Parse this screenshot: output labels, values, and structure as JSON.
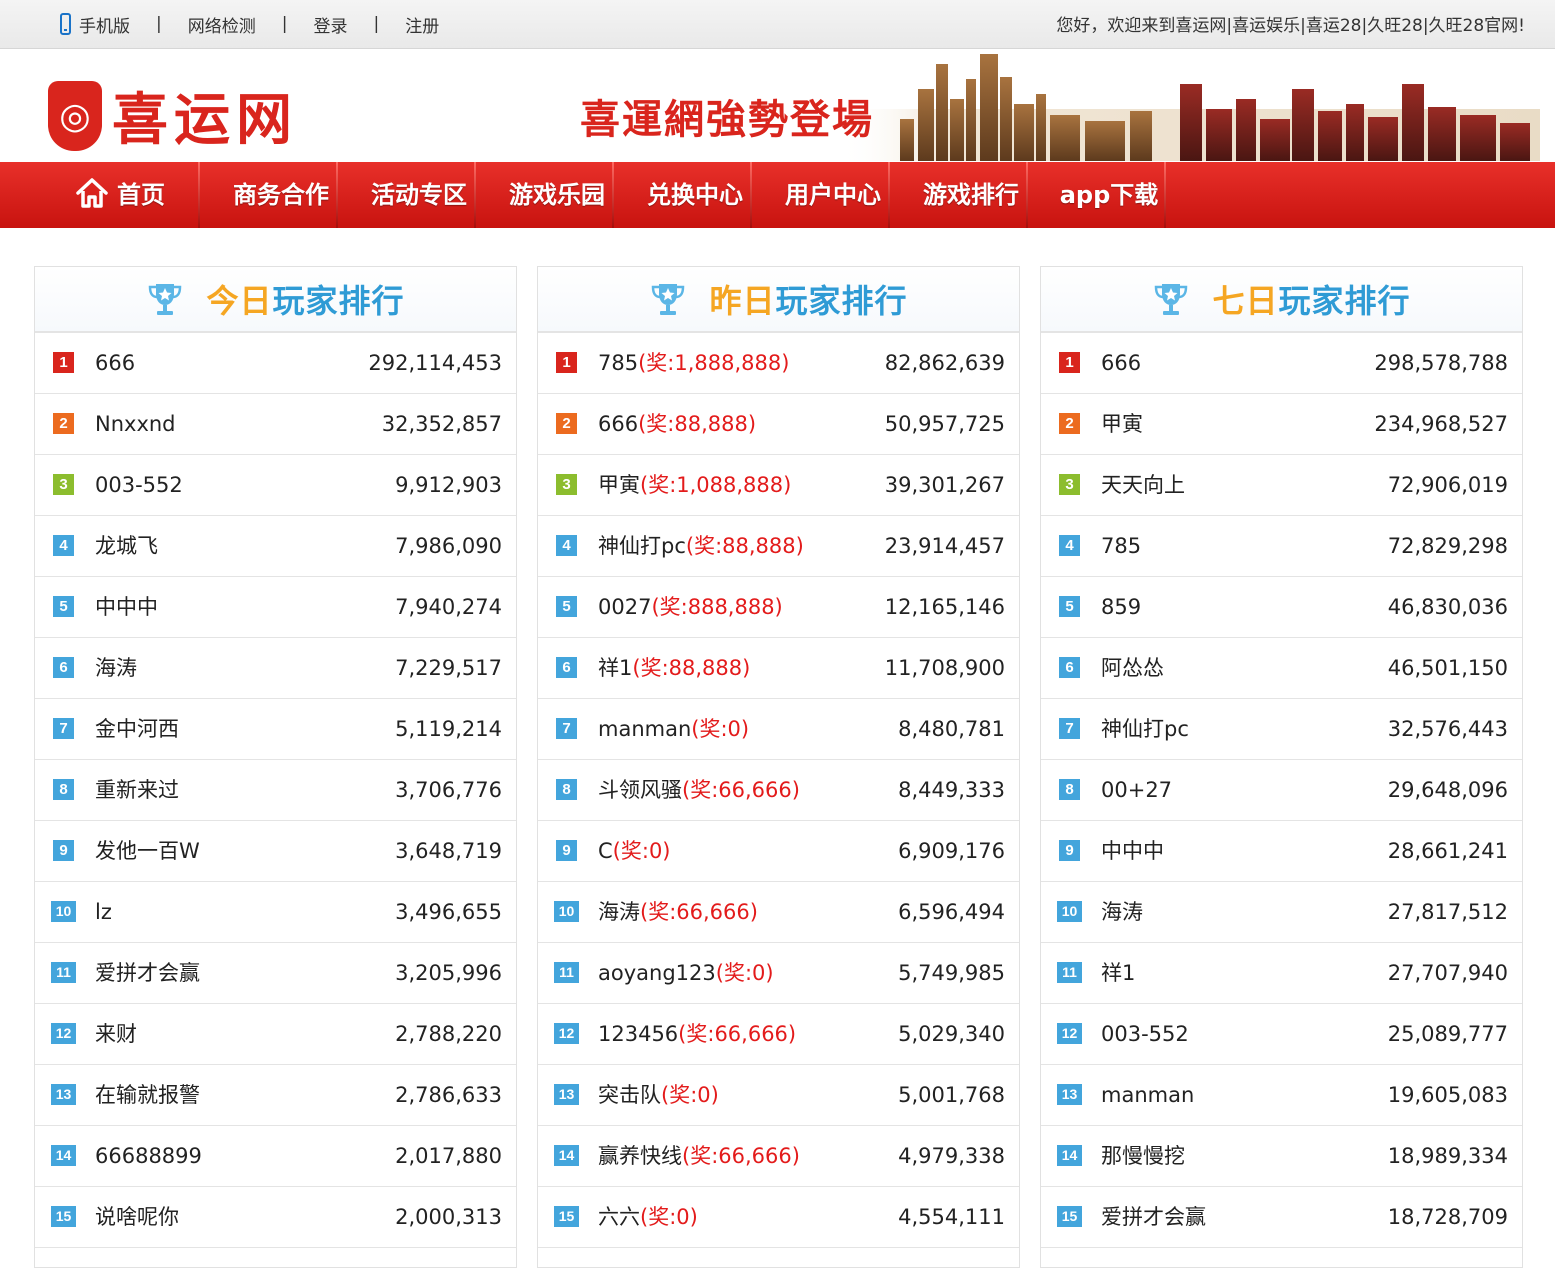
{
  "topbar": {
    "mobile": "手机版",
    "network_check": "网络检测",
    "login": "登录",
    "register": "注册",
    "separator": "|",
    "welcome": "您好，欢迎来到喜运网|喜运娱乐|喜运28|久旺28|久旺28官网!"
  },
  "header": {
    "logo_text": "喜运网",
    "slogan": "喜運網強勢登場"
  },
  "nav": {
    "items": [
      "首页",
      "商务合作",
      "活动专区",
      "游戏乐园",
      "兑换中心",
      "用户中心",
      "游戏排行",
      "app下载"
    ]
  },
  "panels": [
    {
      "title_a": "今日",
      "title_b": "玩家排行",
      "rows": [
        {
          "rank": "1",
          "name": "666",
          "prize": "",
          "score": "292,114,453"
        },
        {
          "rank": "2",
          "name": "Nnxxnd",
          "prize": "",
          "score": "32,352,857"
        },
        {
          "rank": "3",
          "name": "003-552",
          "prize": "",
          "score": "9,912,903"
        },
        {
          "rank": "4",
          "name": "龙城飞",
          "prize": "",
          "score": "7,986,090"
        },
        {
          "rank": "5",
          "name": "中中中",
          "prize": "",
          "score": "7,940,274"
        },
        {
          "rank": "6",
          "name": "海涛",
          "prize": "",
          "score": "7,229,517"
        },
        {
          "rank": "7",
          "name": "金中河西",
          "prize": "",
          "score": "5,119,214"
        },
        {
          "rank": "8",
          "name": "重新来过",
          "prize": "",
          "score": "3,706,776"
        },
        {
          "rank": "9",
          "name": "发他一百W",
          "prize": "",
          "score": "3,648,719"
        },
        {
          "rank": "10",
          "name": "lz",
          "prize": "",
          "score": "3,496,655"
        },
        {
          "rank": "11",
          "name": "爱拼才会赢",
          "prize": "",
          "score": "3,205,996"
        },
        {
          "rank": "12",
          "name": "来财",
          "prize": "",
          "score": "2,788,220"
        },
        {
          "rank": "13",
          "name": "在输就报警",
          "prize": "",
          "score": "2,786,633"
        },
        {
          "rank": "14",
          "name": "66688899",
          "prize": "",
          "score": "2,017,880"
        },
        {
          "rank": "15",
          "name": "说啥呢你",
          "prize": "",
          "score": "2,000,313"
        }
      ]
    },
    {
      "title_a": "昨日",
      "title_b": "玩家排行",
      "rows": [
        {
          "rank": "1",
          "name": "785",
          "prize": "(奖:1,888,888)",
          "score": "82,862,639"
        },
        {
          "rank": "2",
          "name": "666",
          "prize": "(奖:88,888)",
          "score": "50,957,725"
        },
        {
          "rank": "3",
          "name": "甲寅",
          "prize": "(奖:1,088,888)",
          "score": "39,301,267"
        },
        {
          "rank": "4",
          "name": "神仙打pc",
          "prize": "(奖:88,888)",
          "score": "23,914,457"
        },
        {
          "rank": "5",
          "name": "0027",
          "prize": "(奖:888,888)",
          "score": "12,165,146"
        },
        {
          "rank": "6",
          "name": "祥1",
          "prize": "(奖:88,888)",
          "score": "11,708,900"
        },
        {
          "rank": "7",
          "name": "manman",
          "prize": "(奖:0)",
          "score": "8,480,781"
        },
        {
          "rank": "8",
          "name": "斗领风骚",
          "prize": "(奖:66,666)",
          "score": "8,449,333"
        },
        {
          "rank": "9",
          "name": "C",
          "prize": "(奖:0)",
          "score": "6,909,176"
        },
        {
          "rank": "10",
          "name": "海涛",
          "prize": "(奖:66,666)",
          "score": "6,596,494"
        },
        {
          "rank": "11",
          "name": "aoyang123",
          "prize": "(奖:0)",
          "score": "5,749,985"
        },
        {
          "rank": "12",
          "name": "123456",
          "prize": "(奖:66,666)",
          "score": "5,029,340"
        },
        {
          "rank": "13",
          "name": "突击队",
          "prize": "(奖:0)",
          "score": "5,001,768"
        },
        {
          "rank": "14",
          "name": "赢养快线",
          "prize": "(奖:66,666)",
          "score": "4,979,338"
        },
        {
          "rank": "15",
          "name": "六六",
          "prize": "(奖:0)",
          "score": "4,554,111"
        }
      ]
    },
    {
      "title_a": "七日",
      "title_b": "玩家排行",
      "rows": [
        {
          "rank": "1",
          "name": "666",
          "prize": "",
          "score": "298,578,788"
        },
        {
          "rank": "2",
          "name": "甲寅",
          "prize": "",
          "score": "234,968,527"
        },
        {
          "rank": "3",
          "name": "天天向上",
          "prize": "",
          "score": "72,906,019"
        },
        {
          "rank": "4",
          "name": "785",
          "prize": "",
          "score": "72,829,298"
        },
        {
          "rank": "5",
          "name": "859",
          "prize": "",
          "score": "46,830,036"
        },
        {
          "rank": "6",
          "name": "阿怂怂",
          "prize": "",
          "score": "46,501,150"
        },
        {
          "rank": "7",
          "name": "神仙打pc",
          "prize": "",
          "score": "32,576,443"
        },
        {
          "rank": "8",
          "name": "00+27",
          "prize": "",
          "score": "29,648,096"
        },
        {
          "rank": "9",
          "name": "中中中",
          "prize": "",
          "score": "28,661,241"
        },
        {
          "rank": "10",
          "name": "海涛",
          "prize": "",
          "score": "27,817,512"
        },
        {
          "rank": "11",
          "name": "祥1",
          "prize": "",
          "score": "27,707,940"
        },
        {
          "rank": "12",
          "name": "003-552",
          "prize": "",
          "score": "25,089,777"
        },
        {
          "rank": "13",
          "name": "manman",
          "prize": "",
          "score": "19,605,083"
        },
        {
          "rank": "14",
          "name": "那慢慢挖",
          "prize": "",
          "score": "18,989,334"
        },
        {
          "rank": "15",
          "name": "爱拼才会赢",
          "prize": "",
          "score": "18,728,709"
        }
      ]
    }
  ],
  "colors": {
    "brand_red": "#d9251d",
    "prize_red": "#e31b1b",
    "title_orange": "#f5a623",
    "title_blue": "#2f9bd5",
    "rank1": "#d9251d",
    "rank2": "#ec6b1f",
    "rank3": "#8cbd2e",
    "rank_other": "#43a5dc"
  }
}
